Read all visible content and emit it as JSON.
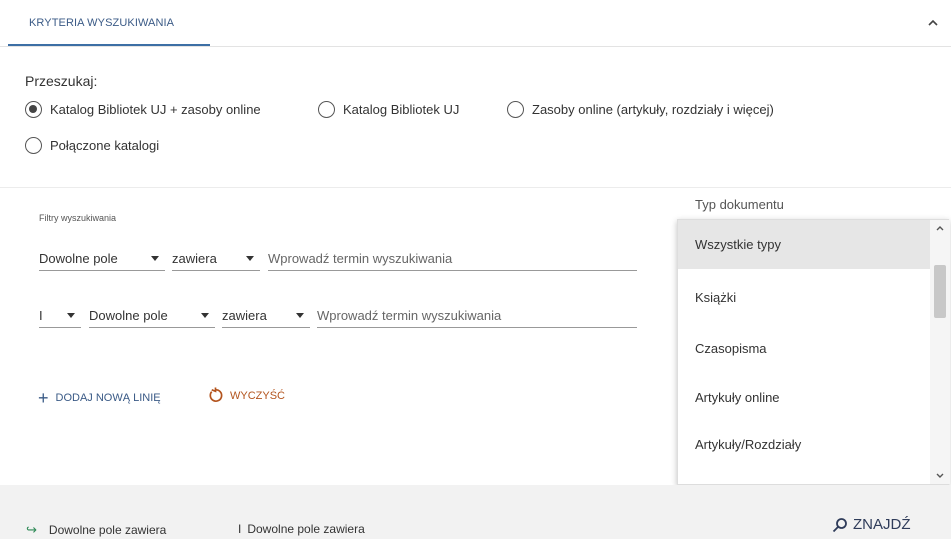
{
  "header": {
    "tab_label": "KRYTERIA WYSZUKIWANIA",
    "collapse_icon": "chevron-up-icon"
  },
  "scope": {
    "title": "Przeszukaj:",
    "options": [
      {
        "label": "Katalog Bibliotek UJ + zasoby online",
        "checked": true
      },
      {
        "label": "Katalog Bibliotek UJ",
        "checked": false
      },
      {
        "label": "Zasoby online (artykuły, rozdziały i więcej)",
        "checked": false
      },
      {
        "label": "Połączone katalogi",
        "checked": false
      }
    ]
  },
  "filters": {
    "title": "Filtry wyszukiwania",
    "row1": {
      "field": "Dowolne pole",
      "operator": "zawiera",
      "placeholder": "Wprowadź termin wyszukiwania"
    },
    "row2": {
      "boolean": "I",
      "field": "Dowolne pole",
      "operator": "zawiera",
      "placeholder": "Wprowadź termin wyszukiwania"
    },
    "add_line_label": "DODAJ NOWĄ LINIĘ",
    "clear_label": "WYCZYŚĆ"
  },
  "doctype": {
    "label": "Typ dokumentu",
    "options": [
      "Wszystkie typy",
      "Książki",
      "Czasopisma",
      "Artykuły online",
      "Artykuły/Rozdziały"
    ],
    "selected_index": 0
  },
  "footer": {
    "summary1": "Dowolne pole zawiera",
    "summary2_prefix": "I",
    "summary2": "Dowolne pole zawiera",
    "find_label": "ZNAJDŹ"
  },
  "colors": {
    "accent_blue": "#3a5a86",
    "clear_orange": "#b3541e",
    "summary_green": "#2f8a57"
  }
}
